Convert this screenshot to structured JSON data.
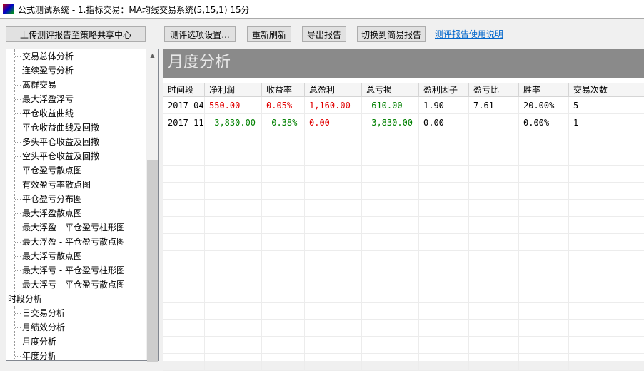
{
  "window": {
    "title": "公式测试系统 - 1.指标交易：MA均线交易系统(5,15,1) 15分"
  },
  "toolbar": {
    "upload": "上传测评报告至策略共享中心",
    "options": "测评选项设置...",
    "refresh": "重新刷新",
    "export": "导出报告",
    "switch": "切换到简易报告",
    "help_link": "测评报告使用说明"
  },
  "tree": {
    "items": [
      {
        "label": "交易总体分析",
        "level": 1
      },
      {
        "label": "连续盈亏分析",
        "level": 1
      },
      {
        "label": "离群交易",
        "level": 1
      },
      {
        "label": "最大浮盈浮亏",
        "level": 1
      },
      {
        "label": "平仓收益曲线",
        "level": 1
      },
      {
        "label": "平仓收益曲线及回撤",
        "level": 1
      },
      {
        "label": "多头平仓收益及回撤",
        "level": 1
      },
      {
        "label": "空头平仓收益及回撤",
        "level": 1
      },
      {
        "label": "平仓盈亏散点图",
        "level": 1
      },
      {
        "label": "有效盈亏率散点图",
        "level": 1
      },
      {
        "label": "平仓盈亏分布图",
        "level": 1
      },
      {
        "label": "最大浮盈散点图",
        "level": 1
      },
      {
        "label": "最大浮盈 - 平仓盈亏柱形图",
        "level": 1
      },
      {
        "label": "最大浮盈 - 平仓盈亏散点图",
        "level": 1
      },
      {
        "label": "最大浮亏散点图",
        "level": 1
      },
      {
        "label": "最大浮亏 - 平仓盈亏柱形图",
        "level": 1
      },
      {
        "label": "最大浮亏 - 平仓盈亏散点图",
        "level": 1
      },
      {
        "label": "时段分析",
        "level": 0
      },
      {
        "label": "日交易分析",
        "level": 1
      },
      {
        "label": "月绩效分析",
        "level": 1
      },
      {
        "label": "月度分析",
        "level": 1
      },
      {
        "label": "年度分析",
        "level": 1
      }
    ]
  },
  "panel": {
    "title": "月度分析"
  },
  "table": {
    "columns": [
      "时间段",
      "净利润",
      "收益率",
      "总盈利",
      "总亏损",
      "盈利因子",
      "盈亏比",
      "胜率",
      "交易次数"
    ],
    "rows": [
      [
        "2017-04",
        "550.00",
        "0.05%",
        "1,160.00",
        "-610.00",
        "1.90",
        "7.61",
        "20.00%",
        "5"
      ],
      [
        "2017-11",
        "-3,830.00",
        "-0.38%",
        "0.00",
        "-3,830.00",
        "0.00",
        "",
        "0.00%",
        "1"
      ]
    ],
    "colors": [
      [
        "",
        "red",
        "red",
        "red",
        "green",
        "",
        "",
        "",
        ""
      ],
      [
        "",
        "green",
        "green",
        "red",
        "green",
        "",
        "",
        "",
        ""
      ]
    ]
  },
  "colors": {
    "positive": "#e00000",
    "negative": "#008000",
    "header_bar": "#8a8a8a"
  }
}
